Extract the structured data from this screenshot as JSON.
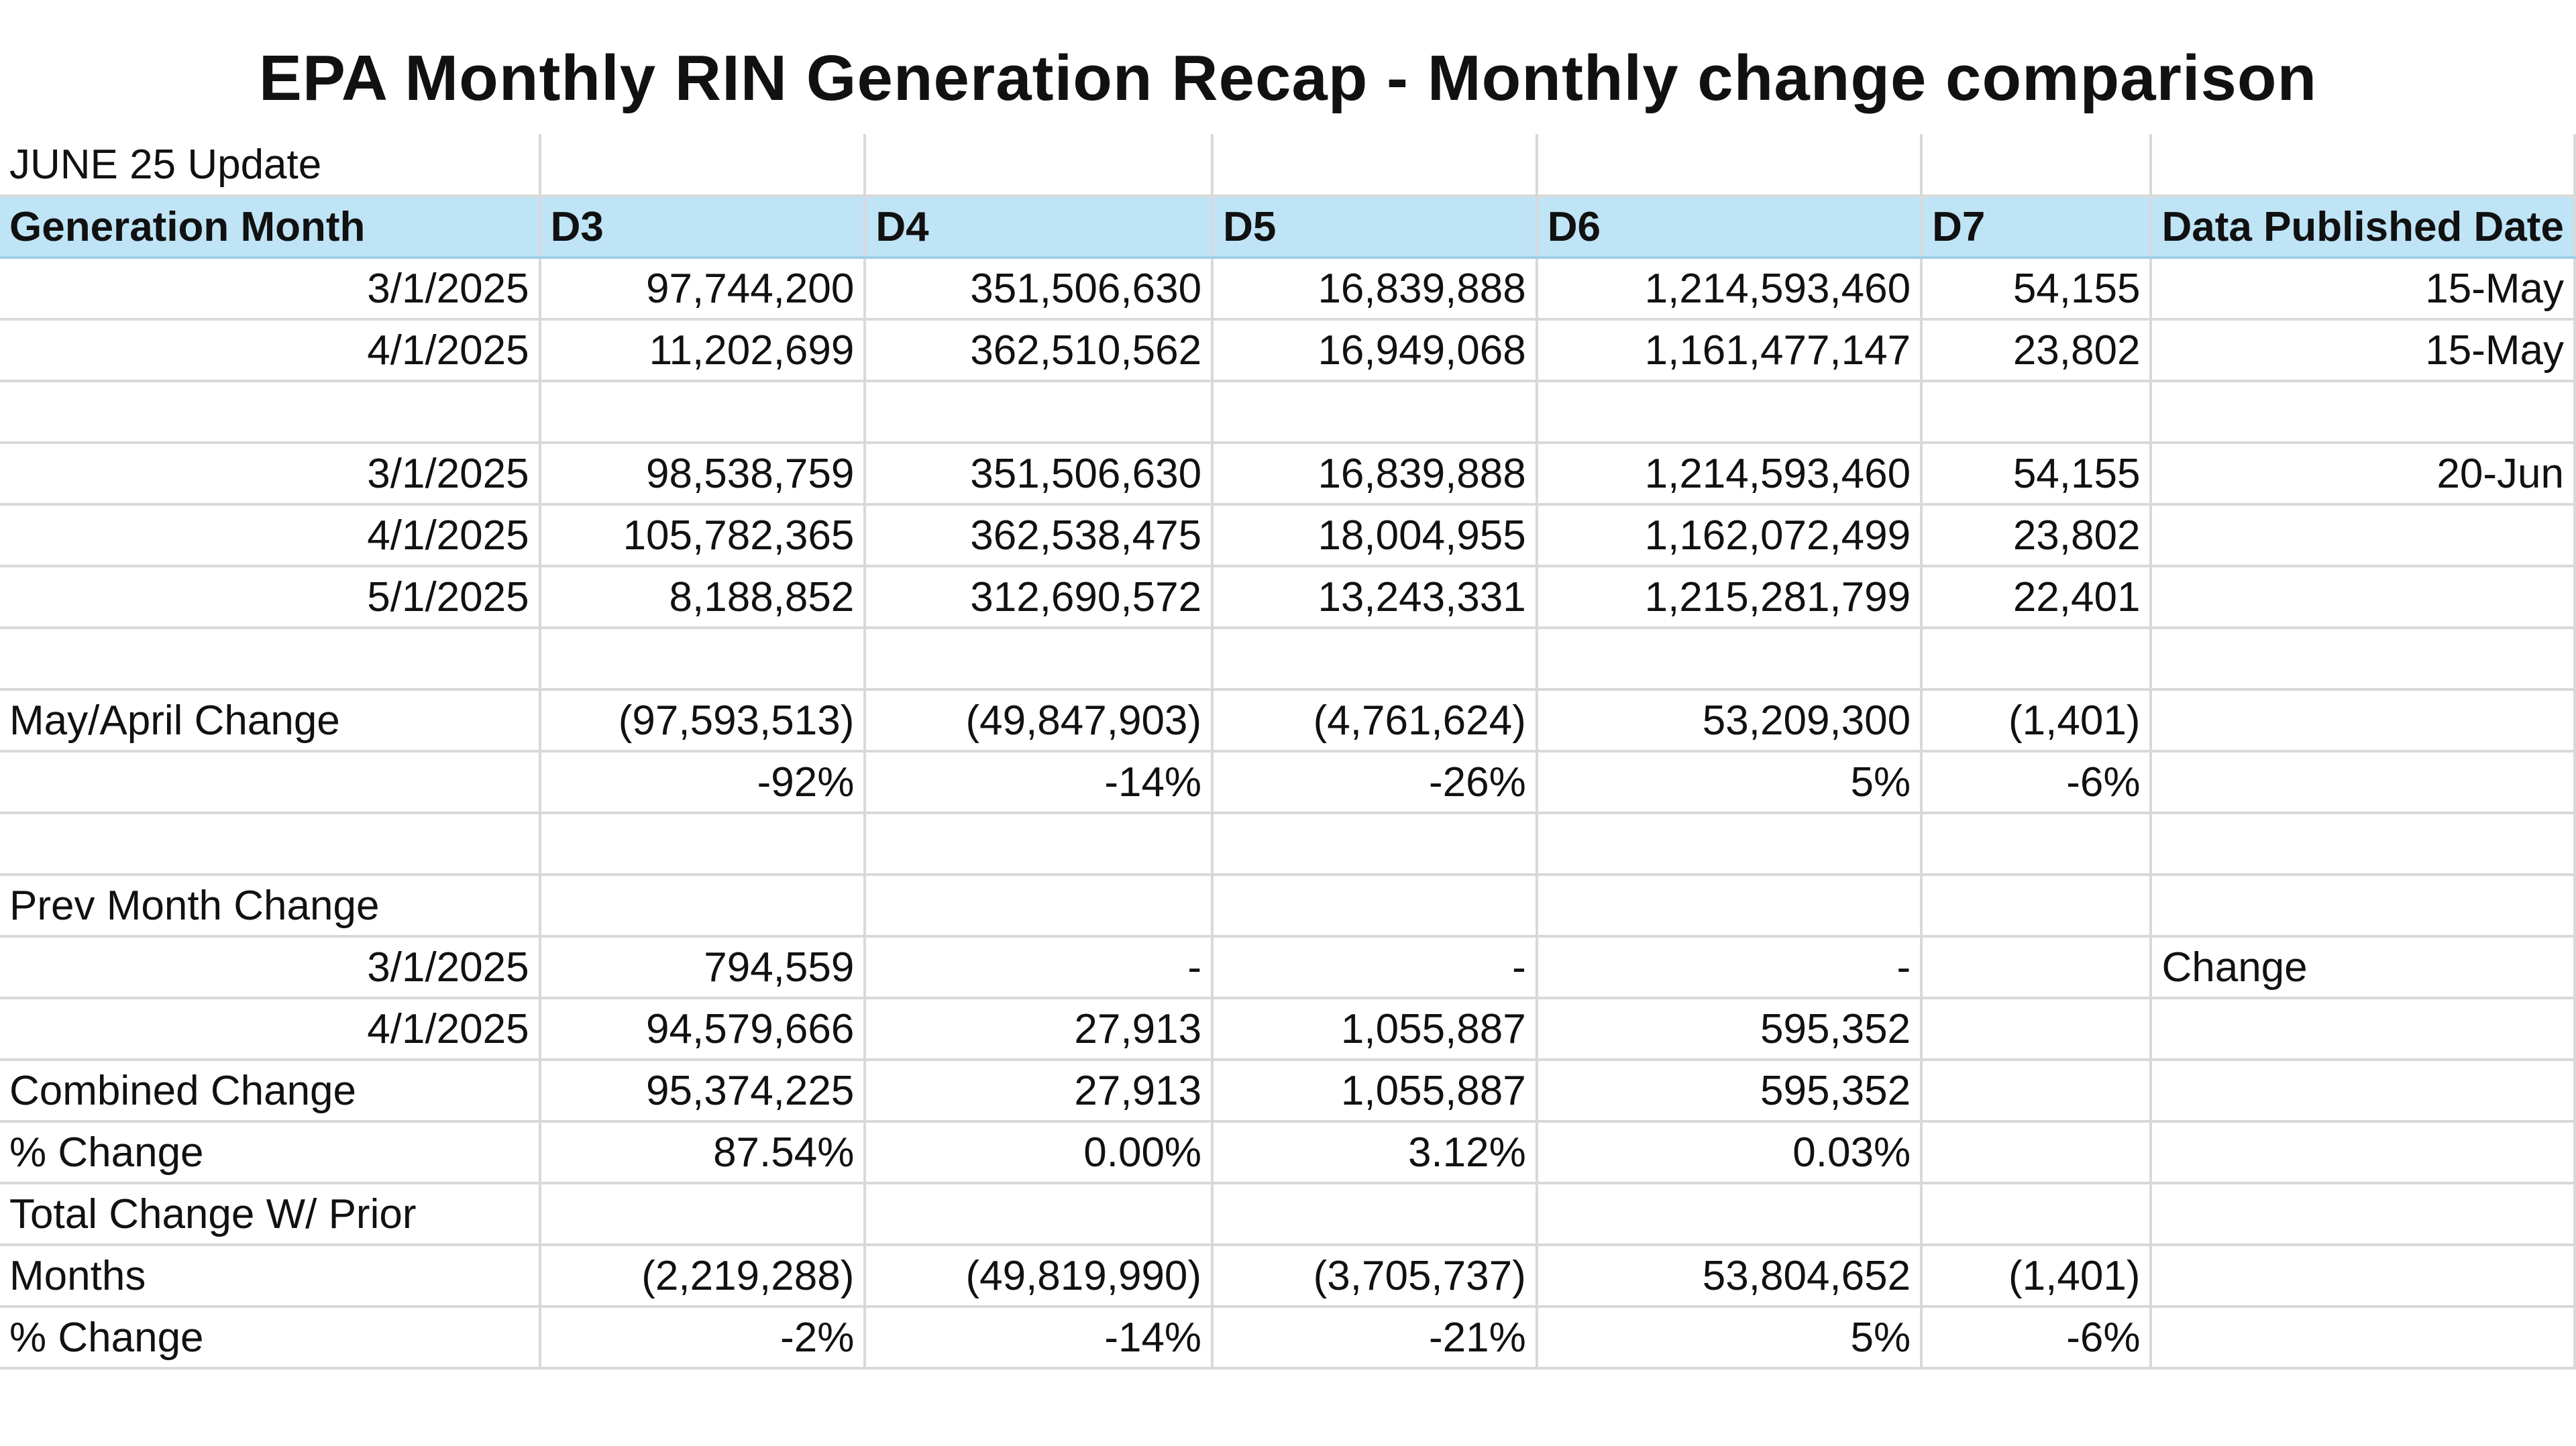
{
  "title": "EPA Monthly RIN Generation Recap - Monthly change comparison",
  "update_label": "JUNE 25 Update",
  "headers": [
    "Generation Month",
    "D3",
    "D4",
    "D5",
    "D6",
    "D7",
    "Data Published Date"
  ],
  "rows": [
    [
      "3/1/2025",
      "97,744,200",
      "351,506,630",
      "16,839,888",
      "1,214,593,460",
      "54,155",
      "15-May"
    ],
    [
      "4/1/2025",
      "11,202,699",
      "362,510,562",
      "16,949,068",
      "1,161,477,147",
      "23,802",
      "15-May"
    ],
    [
      "",
      "",
      "",
      "",
      "",
      "",
      ""
    ],
    [
      "3/1/2025",
      "98,538,759",
      "351,506,630",
      "16,839,888",
      "1,214,593,460",
      "54,155",
      "20-Jun"
    ],
    [
      "4/1/2025",
      "105,782,365",
      "362,538,475",
      "18,004,955",
      "1,162,072,499",
      "23,802",
      ""
    ],
    [
      "5/1/2025",
      "8,188,852",
      "312,690,572",
      "13,243,331",
      "1,215,281,799",
      "22,401",
      ""
    ],
    [
      "",
      "",
      "",
      "",
      "",
      "",
      ""
    ],
    [
      "May/April Change",
      "(97,593,513)",
      "(49,847,903)",
      "(4,761,624)",
      "53,209,300",
      "(1,401)",
      ""
    ],
    [
      "",
      "-92%",
      "-14%",
      "-26%",
      "5%",
      "-6%",
      ""
    ],
    [
      "",
      "",
      "",
      "",
      "",
      "",
      ""
    ],
    [
      "Prev Month Change",
      "",
      "",
      "",
      "",
      "",
      ""
    ],
    [
      "3/1/2025",
      "794,559",
      "-",
      "-",
      "-",
      "",
      "Change"
    ],
    [
      "4/1/2025",
      "94,579,666",
      "27,913",
      "1,055,887",
      "595,352",
      "",
      ""
    ],
    [
      "Combined Change",
      "95,374,225",
      "27,913",
      "1,055,887",
      "595,352",
      "",
      ""
    ],
    [
      "% Change",
      "87.54%",
      "0.00%",
      "3.12%",
      "0.03%",
      "",
      ""
    ],
    [
      "Total Change W/ Prior",
      "",
      "",
      "",
      "",
      "",
      ""
    ],
    [
      "Months",
      "(2,219,288)",
      "(49,819,990)",
      "(3,705,737)",
      "53,804,652",
      "(1,401)",
      ""
    ],
    [
      "% Change",
      "-2%",
      "-14%",
      "-21%",
      "5%",
      "-6%",
      ""
    ]
  ]
}
